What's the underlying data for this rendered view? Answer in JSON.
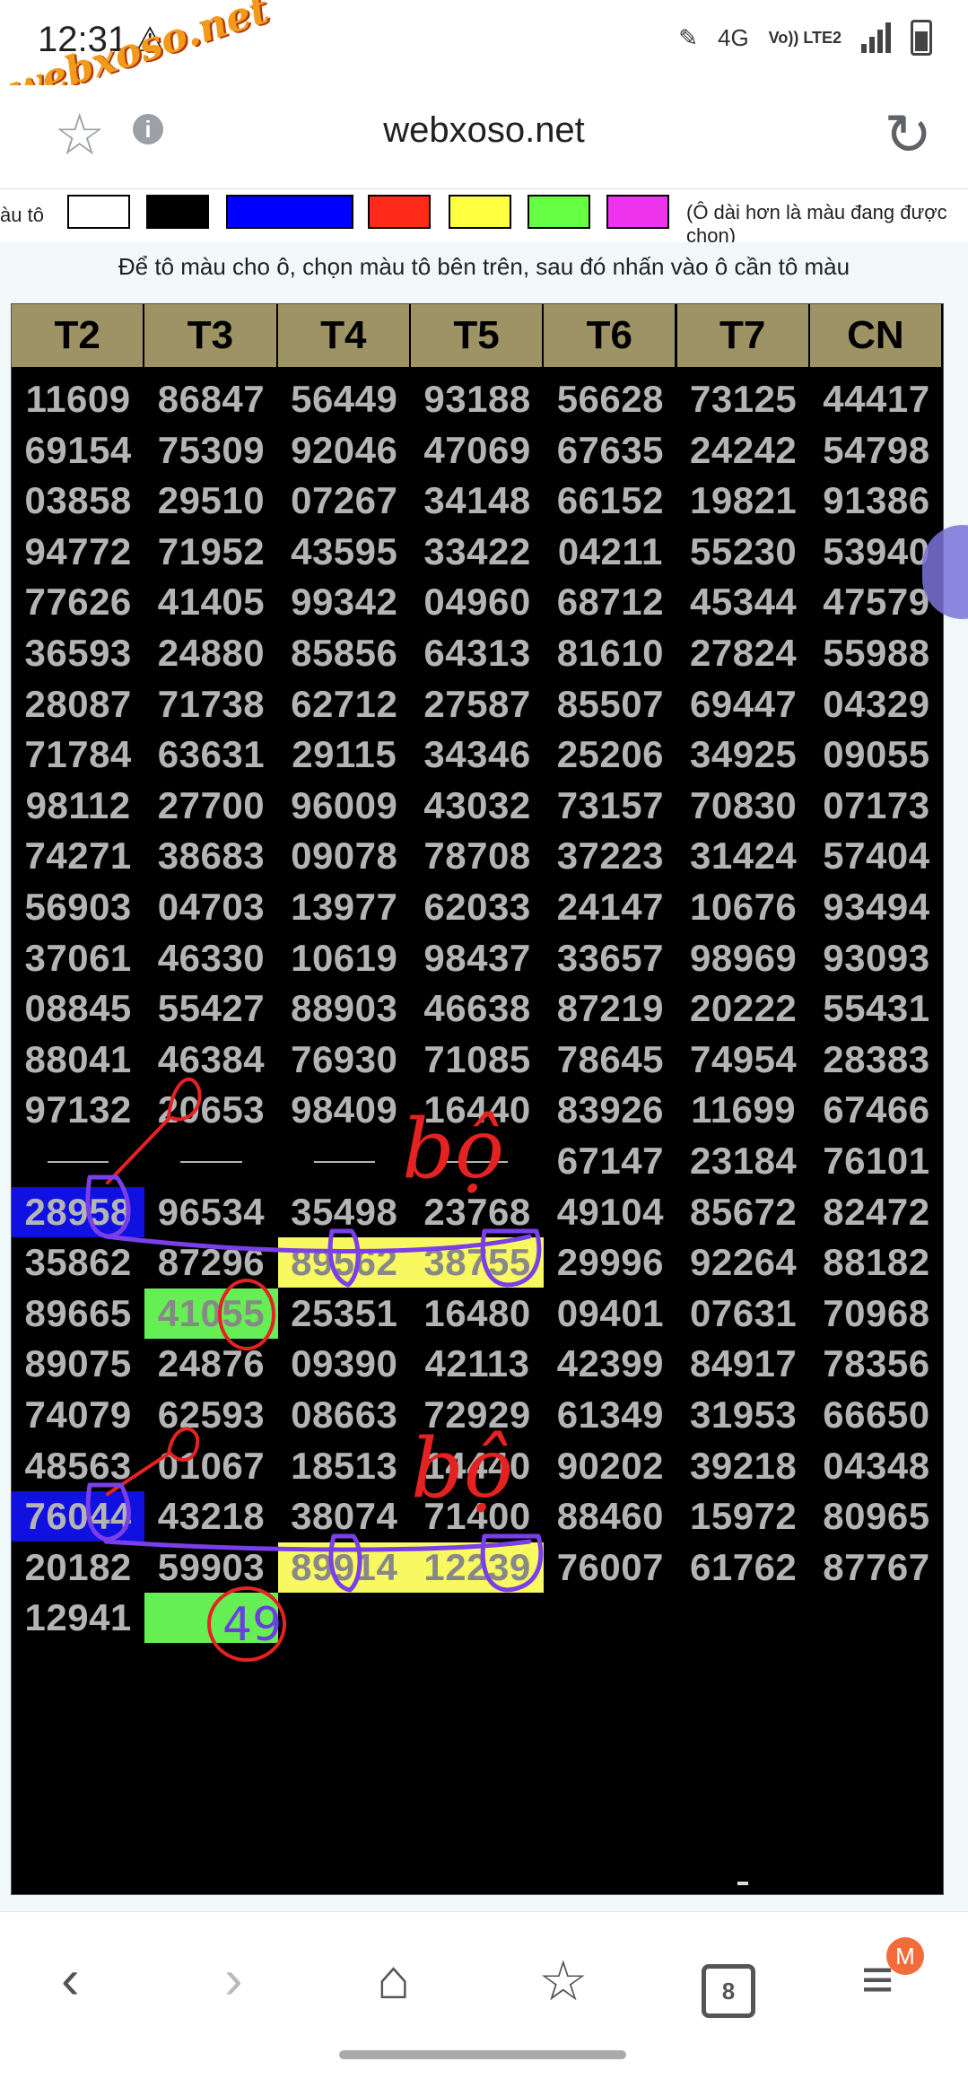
{
  "status_bar": {
    "time": "12:31",
    "warning_icon": "warning-icon",
    "network": "4G",
    "volte": "Vo)) LTE2",
    "watermark": "webxoso.net"
  },
  "browser": {
    "domain": "webxoso.net"
  },
  "palette": {
    "label": "àu tô",
    "colors": [
      "#ffffff",
      "#000000",
      "#0000ff",
      "#ff2a1a",
      "#ffff40",
      "#66ff44",
      "#ee33ee"
    ],
    "note": "(Ô dài hơn là màu đang được chọn)"
  },
  "instruction": "Để tô màu cho ô, chọn màu tô bên trên, sau đó nhấn vào ô cần tô màu",
  "table": {
    "headers": [
      "T2",
      "T3",
      "T4",
      "T5",
      "T6",
      "T7",
      "CN"
    ],
    "rows": [
      [
        "11609",
        "86847",
        "56449",
        "93188",
        "56628",
        "73125",
        "44417"
      ],
      [
        "69154",
        "75309",
        "92046",
        "47069",
        "67635",
        "24242",
        "54798"
      ],
      [
        "03858",
        "29510",
        "07267",
        "34148",
        "66152",
        "19821",
        "91386"
      ],
      [
        "94772",
        "71952",
        "43595",
        "33422",
        "04211",
        "55230",
        "53940"
      ],
      [
        "77626",
        "41405",
        "99342",
        "04960",
        "68712",
        "45344",
        "47579"
      ],
      [
        "36593",
        "24880",
        "85856",
        "64313",
        "81610",
        "27824",
        "55988"
      ],
      [
        "28087",
        "71738",
        "62712",
        "27587",
        "85507",
        "69447",
        "04329"
      ],
      [
        "71784",
        "63631",
        "29115",
        "34346",
        "25206",
        "34925",
        "09055"
      ],
      [
        "98112",
        "27700",
        "96009",
        "43032",
        "73157",
        "70830",
        "07173"
      ],
      [
        "74271",
        "38683",
        "09078",
        "78708",
        "37223",
        "31424",
        "57404"
      ],
      [
        "56903",
        "04703",
        "13977",
        "62033",
        "24147",
        "10676",
        "93494"
      ],
      [
        "37061",
        "46330",
        "10619",
        "98437",
        "33657",
        "98969",
        "93093"
      ],
      [
        "08845",
        "55427",
        "88903",
        "46638",
        "87219",
        "20222",
        "55431"
      ],
      [
        "88041",
        "46384",
        "76930",
        "71085",
        "78645",
        "74954",
        "28383"
      ],
      [
        "97132",
        "20653",
        "98409",
        "16440",
        "83926",
        "11699",
        "67466"
      ],
      [
        "",
        "",
        "",
        "",
        "67147",
        "23184",
        "76101"
      ],
      [
        "28958",
        "96534",
        "35498",
        "23768",
        "49104",
        "85672",
        "82472"
      ],
      [
        "35862",
        "87296",
        "89562",
        "38755",
        "29996",
        "92264",
        "88182"
      ],
      [
        "89665",
        "41055",
        "25351",
        "16480",
        "09401",
        "07631",
        "70968"
      ],
      [
        "89075",
        "24876",
        "09390",
        "42113",
        "42399",
        "84917",
        "78356"
      ],
      [
        "74079",
        "62593",
        "08663",
        "72929",
        "61349",
        "31953",
        "66650"
      ],
      [
        "48563",
        "01067",
        "18513",
        "14440",
        "90202",
        "39218",
        "04348"
      ],
      [
        "76044",
        "43218",
        "38074",
        "71400",
        "88460",
        "15972",
        "80965"
      ],
      [
        "20182",
        "59903",
        "89914",
        "12239",
        "76007",
        "61762",
        "87767"
      ],
      [
        "12941",
        "",
        "",
        "",
        "",
        "",
        ""
      ]
    ]
  },
  "annotations": {
    "note_1": "bộ",
    "note_2": "bộ",
    "circled": "49"
  },
  "bottom_nav": {
    "tab_count": "8",
    "avatar_letter": "M"
  }
}
